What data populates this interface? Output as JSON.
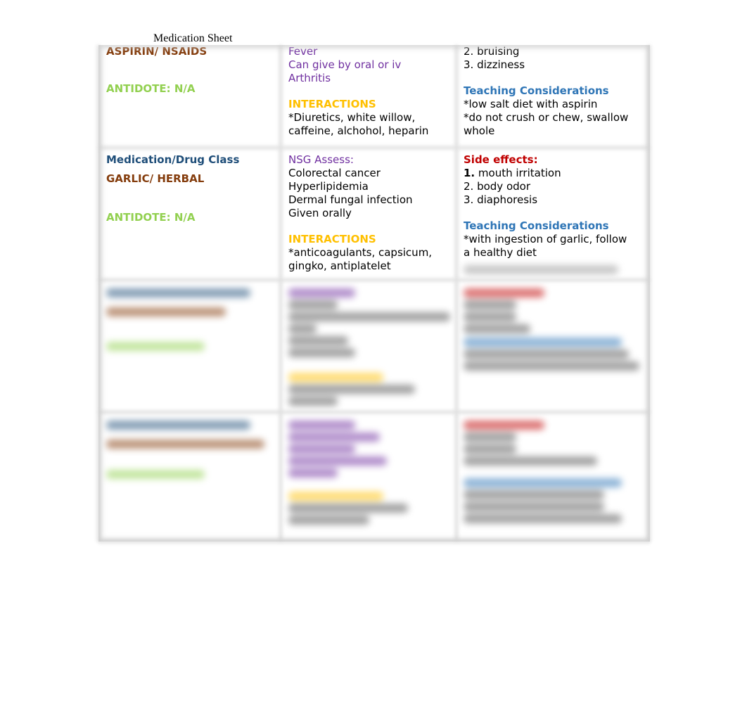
{
  "document": {
    "title": "Medication Sheet"
  },
  "colors": {
    "drug_name": "#843c0c",
    "antidote": "#92d050",
    "header_navy": "#1f4e79",
    "assess_purple": "#7030a0",
    "interactions_gold": "#ffc000",
    "side_effects_red": "#c00000",
    "teaching_blue": "#2e75b6"
  },
  "rows": [
    {
      "drug": "ASPIRIN/ NSAIDS",
      "antidote": "ANTIDOTE: N/A",
      "assess_lines": [
        "Fever",
        "Can give by oral or iv",
        "Arthritis"
      ],
      "interactions_label": "INTERACTIONS",
      "interactions_lines": [
        "*Diuretics, white willow,",
        "caffeine, alchohol, heparin"
      ],
      "side_effects_lines": [
        "2. bruising",
        "3. dizziness"
      ],
      "teaching_label": "Teaching Considerations",
      "teaching_lines": [
        "*low salt diet with aspirin",
        "*do not crush or chew, swallow",
        "whole"
      ]
    },
    {
      "class_label": "Medication/Drug Class",
      "drug": "GARLIC/ HERBAL",
      "antidote": "ANTIDOTE: N/A",
      "assess_label": "NSG Assess:",
      "assess_lines": [
        "Colorectal cancer",
        "Hyperlipidemia",
        "Dermal fungal infection",
        "Given orally"
      ],
      "interactions_label": "INTERACTIONS",
      "interactions_lines": [
        "*anticoagulants, capsicum,",
        "gingko, antiplatelet"
      ],
      "side_effects_label": "Side effects:",
      "side_effects_first_num": "1.",
      "side_effects_first_text": " mouth irritation",
      "side_effects_lines": [
        "2. body odor",
        "3. diaphoresis"
      ],
      "teaching_label": "Teaching Considerations",
      "teaching_lines": [
        "*with ingestion of garlic, follow",
        "a healthy diet"
      ]
    }
  ]
}
